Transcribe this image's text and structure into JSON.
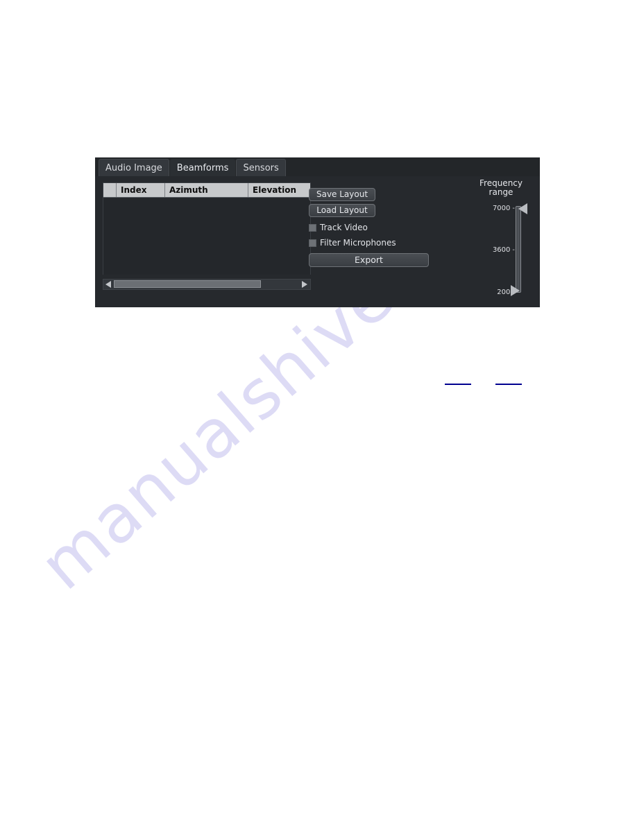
{
  "page": {
    "background_color": "#ffffff",
    "watermark_text": "manualshive.com",
    "watermark_color": "#3a33c8"
  },
  "panel": {
    "background_color": "#26292d",
    "accent_color": "#c7c9cb"
  },
  "tabs": [
    {
      "label": "Audio Image",
      "active": false
    },
    {
      "label": "Beamforms",
      "active": true
    },
    {
      "label": "Sensors",
      "active": false
    }
  ],
  "table": {
    "columns": [
      "",
      "Index",
      "Azimuth",
      "Elevation"
    ],
    "rows": []
  },
  "scrollbar": {
    "left_arrow_icon": "triangle-left-icon",
    "right_arrow_icon": "triangle-right-icon"
  },
  "controls": {
    "save_layout_label": "Save Layout",
    "load_layout_label": "Load Layout",
    "track_video_label": "Track Video",
    "track_video_checked": false,
    "filter_microphones_label": "Filter Microphones",
    "filter_microphones_checked": false,
    "export_label": "Export"
  },
  "frequency_range": {
    "title_line1": "Frequency",
    "title_line2": "range",
    "max_label": "7000",
    "mid_label": "3600",
    "min_label": "200",
    "tick_dash": "-",
    "high_value": 7000,
    "low_value": 200,
    "mid_value": 3600
  }
}
